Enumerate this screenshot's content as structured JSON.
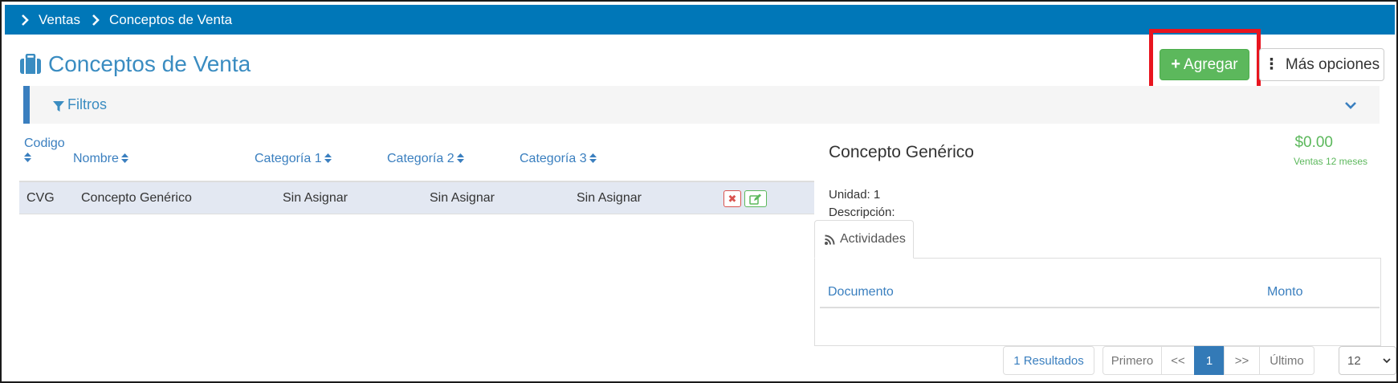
{
  "breadcrumb": {
    "items": [
      "Ventas",
      "Conceptos de Venta"
    ]
  },
  "page": {
    "title": "Conceptos de Venta",
    "title_icon": "briefcase-icon"
  },
  "actions": {
    "add_label": "Agregar",
    "more_label": "Más opciones"
  },
  "filters": {
    "label": "Filtros"
  },
  "table": {
    "columns": [
      "Codigo",
      "Nombre",
      "Categoría 1",
      "Categoría 2",
      "Categoría 3"
    ],
    "rows": [
      {
        "codigo": "CVG",
        "nombre": "Concepto Genérico",
        "cat1": "Sin Asignar",
        "cat2": "Sin Asignar",
        "cat3": "Sin Asignar"
      }
    ]
  },
  "detail": {
    "name": "Concepto Genérico",
    "amount": "$0.00",
    "amount_label": "Ventas 12 meses",
    "unit": "Unidad: 1",
    "description": "Descripción:",
    "tab": "Actividades",
    "columns": [
      "Documento",
      "Monto"
    ]
  },
  "pagination": {
    "results": "1 Resultados",
    "first": "Primero",
    "prev": "<<",
    "current": "1",
    "next": ">>",
    "last": "Último",
    "page_size": "12"
  },
  "colors": {
    "topbar": "#0077b8",
    "accent": "#3a8cc1",
    "success": "#5cb85c",
    "danger": "#d9534f",
    "highlight": "#e8151f"
  }
}
